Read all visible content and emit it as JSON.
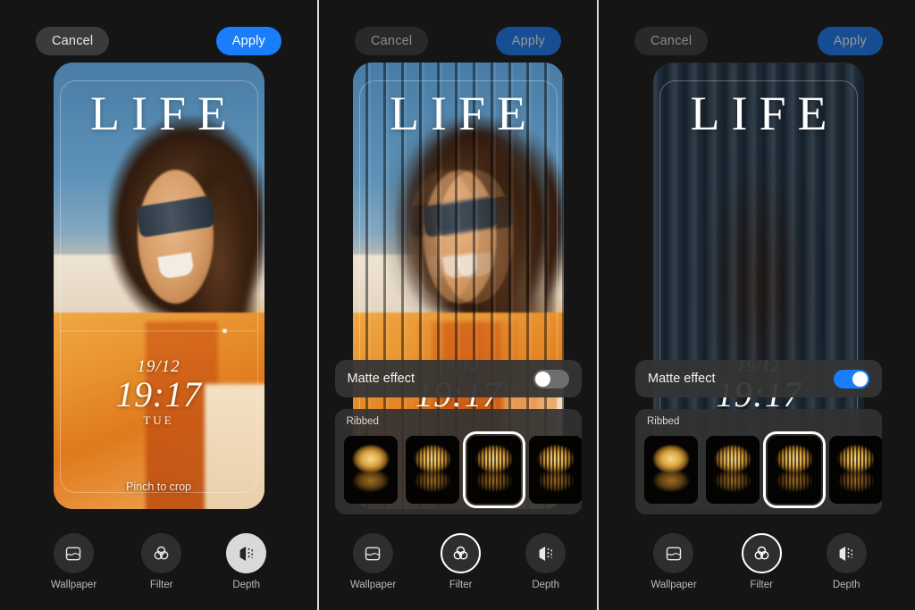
{
  "app": {
    "background_color": "#141414",
    "accent_color": "#1a7dfa"
  },
  "actions": {
    "cancel_label": "Cancel",
    "apply_label": "Apply"
  },
  "preview": {
    "wordmark": "LIFE",
    "clock": {
      "date": "19/12",
      "time": "19:17",
      "day_of_week": "TUE"
    },
    "hint": "Pinch to crop"
  },
  "matte": {
    "label": "Matte effect",
    "state_off": "off",
    "state_on": "on"
  },
  "carousel": {
    "category": "Ribbed",
    "thumbnails": [
      {
        "name": "ribbed-0"
      },
      {
        "name": "ribbed-1"
      },
      {
        "name": "ribbed-2"
      },
      {
        "name": "ribbed-3"
      },
      {
        "name": "ribbed-4"
      }
    ],
    "selected_index": 2
  },
  "toolbar": {
    "items": [
      {
        "label": "Wallpaper",
        "icon": "wallpaper-icon"
      },
      {
        "label": "Filter",
        "icon": "filter-icon"
      },
      {
        "label": "Depth",
        "icon": "depth-icon"
      }
    ]
  },
  "panels": [
    {
      "id": "panel-1",
      "active_tool": "Depth",
      "shows_matte_row": false,
      "shows_carousel": false
    },
    {
      "id": "panel-2",
      "active_tool": "Filter",
      "shows_matte_row": true,
      "shows_carousel": true,
      "matte_on": false
    },
    {
      "id": "panel-3",
      "active_tool": "Filter",
      "shows_matte_row": true,
      "shows_carousel": true,
      "matte_on": true
    }
  ]
}
